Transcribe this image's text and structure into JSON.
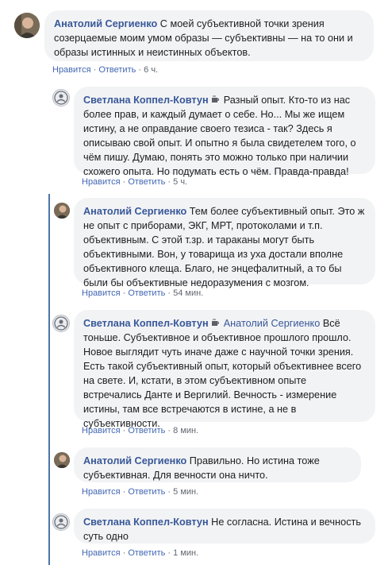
{
  "comments": [
    {
      "author": "Анатолий Сергиенко",
      "text": "С моей субъективной точки зрения созерцаемые моим умом образы — субъективны — на то они и образы истинных и неистинных объектов.",
      "like": "Нравится",
      "reply": "Ответить",
      "time": "6 ч."
    },
    {
      "author": "Светлана Коппел-Ковтун",
      "text": "Разный опыт. Кто-то из нас более прав, и каждый думает о себе. Но... Мы же ищем истину, а не оправдание своего тезиса - так? Здесь я описываю свой опыт. И опытно я была свидетелем того, о чём пишу. Думаю, понять это можно только при наличии схожего опыта. Но подумать есть о чём. Правда-правда!",
      "like": "Нравится",
      "reply": "Ответить",
      "time": "5 ч."
    },
    {
      "author": "Анатолий Сергиенко",
      "text": "Тем более субъективный опыт. Это ж не опыт с приборами, ЭКГ, МРТ, протоколами и т.п. объективным. С этой т.зр. и тараканы могут быть объективными. Вон, у товарища из уха достали вполне объективного клеща. Благо, не энцефалитный, а то бы были бы объективные недоразумения с мозгом.",
      "like": "Нравится",
      "reply": "Ответить",
      "time": "54 мин."
    },
    {
      "author": "Светлана Коппел-Ковтун",
      "mention": "Анатолий Сергиенко",
      "text": "Всё тоньше. Субъективное и объективное прошлого прошло. Новое выглядит чуть иначе даже с научной точки зрения. Есть такой субъективный опыт, который объективнее всего на свете. И, кстати, в этом субъективном опыте встречались Данте и Вергилий. Вечность - измерение истины, там все встречаются в истине, а не в субъективности.",
      "like": "Нравится",
      "reply": "Ответить",
      "time": "8 мин."
    },
    {
      "author": "Анатолий Сергиенко",
      "text": "Правильно. Но истина тоже субъективная. Для вечности она ничто.",
      "like": "Нравится",
      "reply": "Ответить",
      "time": "5 мин."
    },
    {
      "author": "Светлана Коппел-Ковтун",
      "text": "Не согласна. Истина и вечность суть одно",
      "like": "Нравится",
      "reply": "Ответить",
      "time": "1 мин."
    }
  ],
  "colors": {
    "link": "#385898",
    "bubble": "#f2f3f5",
    "meta": "#616770",
    "thread_line": "#4a76a8"
  },
  "icons": [
    "avatar-anatoly",
    "avatar-svetlana",
    "coffee-cup-icon"
  ]
}
